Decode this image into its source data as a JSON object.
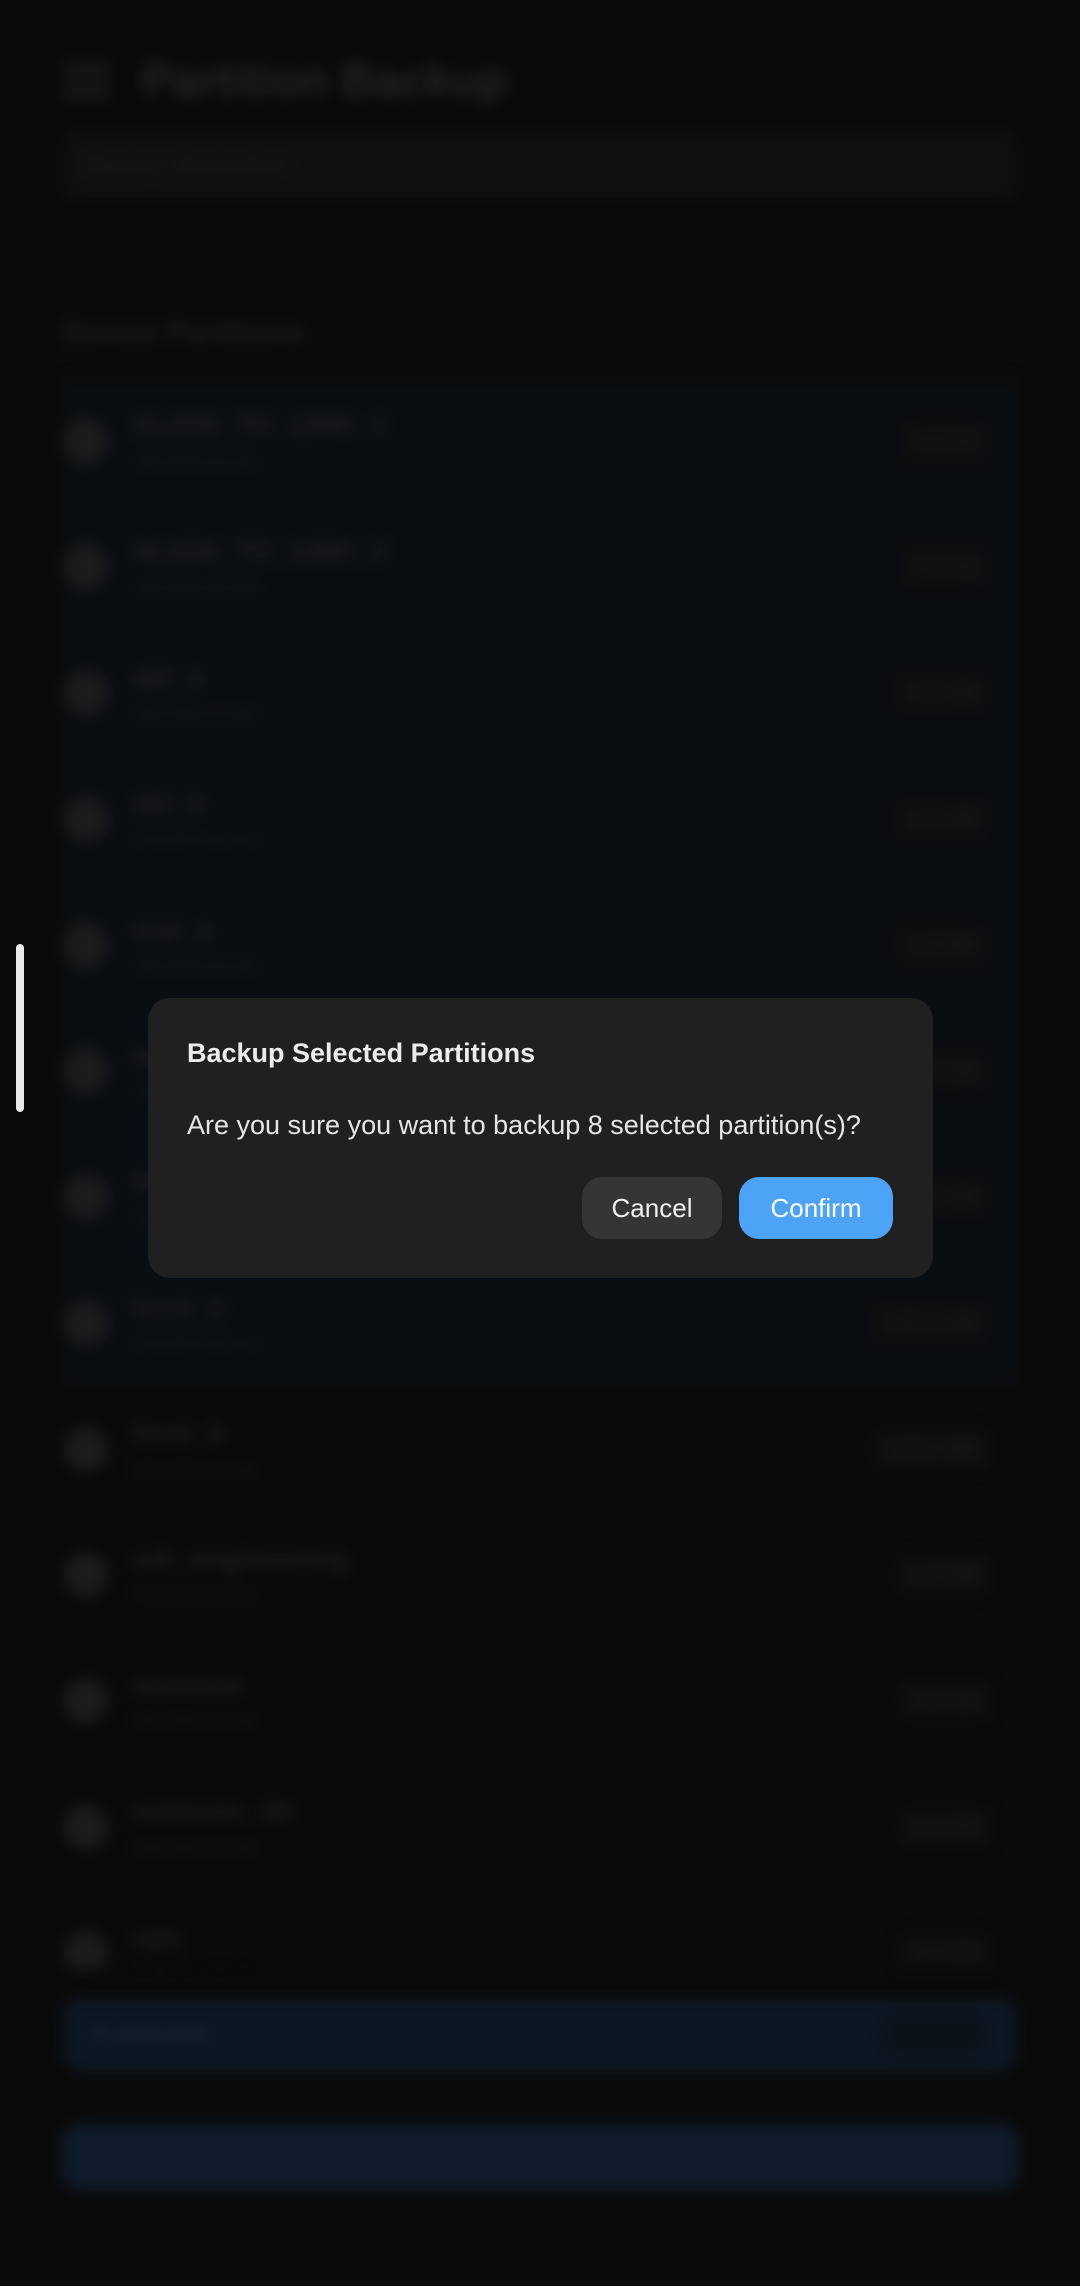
{
  "app": {
    "title": "Partition Backup",
    "info_text": "Backup destination",
    "section_title": "Device Partitions"
  },
  "partitions": [
    {
      "name": "ALIGN_TO_128K_1",
      "sub": "/dev/block/sda",
      "size": "4.0 KB",
      "selected": true
    },
    {
      "name": "ALIGN_TO_128K_2",
      "sub": "/dev/block/sdb",
      "size": "4.0 KB",
      "selected": true
    },
    {
      "name": "abl_a",
      "sub": "/dev/block/sde",
      "size": "8.0 MB",
      "selected": true
    },
    {
      "name": "abl_b",
      "sub": "/dev/block/sde",
      "size": "8.0 MB",
      "selected": true
    },
    {
      "name": "aop_a",
      "sub": "/dev/block/sde",
      "size": "2.0 MB",
      "selected": true
    },
    {
      "name": "aop_b",
      "sub": "/dev/block/sde",
      "size": "2.0 MB",
      "selected": true
    },
    {
      "name": "bluetooth_a",
      "sub": "/dev/block/sde",
      "size": "1.0 MB",
      "selected": true
    },
    {
      "name": "boot_a",
      "sub": "/dev/block/sde",
      "size": "128.0 MB",
      "selected": true
    },
    {
      "name": "boot_b",
      "sub": "/dev/block/sde",
      "size": "128.0 MB",
      "selected": false
    },
    {
      "name": "cdt_engineering",
      "sub": "/dev/block/sde",
      "size": "1.0 MB",
      "selected": false
    },
    {
      "name": "connsec",
      "sub": "/dev/block/sde",
      "size": "4.0 KB",
      "selected": false
    },
    {
      "name": "connsec_bk",
      "sub": "/dev/block/sde",
      "size": "4.0 KB",
      "selected": false
    },
    {
      "name": "cpu",
      "sub": "/dev/block/sde",
      "size": "4.0 KB",
      "selected": false
    }
  ],
  "selection_bar": {
    "count_text": "8 selected"
  },
  "dialog": {
    "title": "Backup Selected Partitions",
    "message": "Are you sure you want to backup 8 selected partition(s)?",
    "cancel_label": "Cancel",
    "confirm_label": "Confirm"
  },
  "colors": {
    "dialog_bg": "#202020",
    "confirm_bg": "#4da3f5",
    "cancel_bg": "#353535"
  }
}
